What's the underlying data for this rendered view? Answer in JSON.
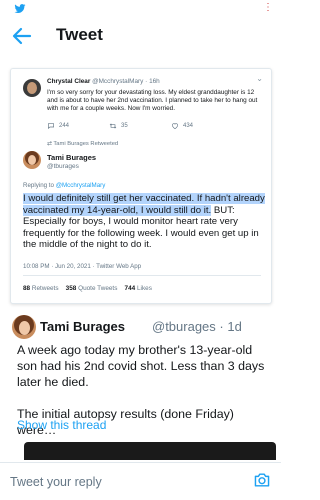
{
  "header": {
    "title": "Tweet",
    "accent_color": "#1da1f2"
  },
  "embedded_tweet": {
    "reply_context": {
      "name": "Chrystal Clear",
      "handle": "@McchrystalMary",
      "time": "16h",
      "text": "I'm so very sorry for your devastating loss. My eldest granddaughter is 12 and is about to have her 2nd vaccination. I planned to take her to hang out with me for a couple weeks. Now I'm worried.",
      "replies": "244",
      "retweets": "35",
      "likes": "434"
    },
    "retweeted_by": "Tami Burages Retweeted",
    "author_name": "Tami Burages",
    "author_handle": "@tburages",
    "replying_prefix": "Replying to",
    "replying_to": "@McchrystalMary",
    "text_highlighted": "I would definitely still get her vaccinated. If hadn't already vaccinated my 14-year-old, I would still do it.",
    "text_rest": " BUT: Especially for boys, I would monitor heart rate very frequently for the following week. I would even get up in the middle of the night to do it.",
    "timestamp": "10:08 PM · Jun 20, 2021 · Twitter Web App",
    "retweets_count": "88",
    "retweets_label": "Retweets",
    "quote_count": "358",
    "quote_label": "Quote Tweets",
    "likes_count": "744",
    "likes_label": "Likes"
  },
  "main_tweet": {
    "author_name": "Tami Burages",
    "author_handle": "@tburages · 1d",
    "text": "A week ago today my brother's 13-year-old son had his 2nd covid shot.  Less than 3 days later he died.\n\nThe initial autopsy results (done Friday) were…",
    "show_thread": "Show this thread"
  },
  "reply_bar": {
    "placeholder": "Tweet your reply"
  },
  "icons": [
    "twitter-bird-icon",
    "more-options-icon",
    "back-arrow-icon",
    "menu-chevron-icon",
    "reply-icon",
    "retweet-icon",
    "like-icon",
    "camera-icon"
  ]
}
